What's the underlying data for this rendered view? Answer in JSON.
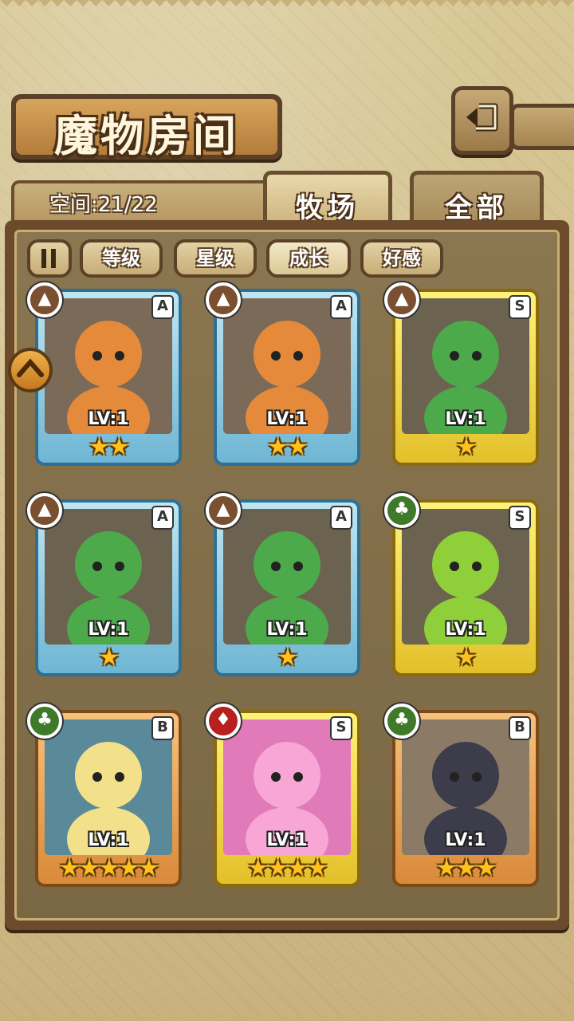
{
  "header": {
    "title": "魔物房间",
    "back_icon": "back-arrow-icon"
  },
  "space": {
    "label": "空间:21/22"
  },
  "tabs": [
    {
      "label": "牧场",
      "active": true
    },
    {
      "label": "全部",
      "active": false
    }
  ],
  "filters": {
    "sort_icon": "pause-icon",
    "items": [
      {
        "label": "等级",
        "active": false
      },
      {
        "label": "星级",
        "active": false
      },
      {
        "label": "成长",
        "active": true
      },
      {
        "label": "好感",
        "active": false
      }
    ]
  },
  "cards": [
    {
      "element": "earth-icon",
      "rank": "A",
      "level": "LV:1",
      "stars": 2,
      "frame": "blue",
      "subject": "scarecrow-witch"
    },
    {
      "element": "earth-icon",
      "rank": "A",
      "level": "LV:1",
      "stars": 2,
      "frame": "blue",
      "subject": "scarecrow-witch"
    },
    {
      "element": "earth-icon",
      "rank": "S",
      "level": "LV:1",
      "stars": 1,
      "frame": "gold",
      "subject": "leaf-girl"
    },
    {
      "element": "earth-icon",
      "rank": "A",
      "level": "LV:1",
      "stars": 1,
      "frame": "blue",
      "subject": "leaf-girl"
    },
    {
      "element": "earth-icon",
      "rank": "A",
      "level": "LV:1",
      "stars": 1,
      "frame": "blue",
      "subject": "leaf-girl"
    },
    {
      "element": "grass-icon",
      "rank": "S",
      "level": "LV:1",
      "stars": 1,
      "frame": "gold",
      "subject": "slime-plant"
    },
    {
      "element": "grass-icon",
      "rank": "B",
      "level": "LV:1",
      "stars": 5,
      "frame": "orange",
      "subject": "elf-girl"
    },
    {
      "element": "fire-icon",
      "rank": "S",
      "level": "LV:1",
      "stars": 4,
      "frame": "gold",
      "subject": "pink-slime-girl"
    },
    {
      "element": "grass-icon",
      "rank": "B",
      "level": "LV:1",
      "stars": 3,
      "frame": "orange",
      "subject": "dark-hair-girl"
    }
  ],
  "colors": {
    "panel": "#6b4b2c",
    "star": "#ffc11e",
    "text_outline": "#4a3018"
  }
}
